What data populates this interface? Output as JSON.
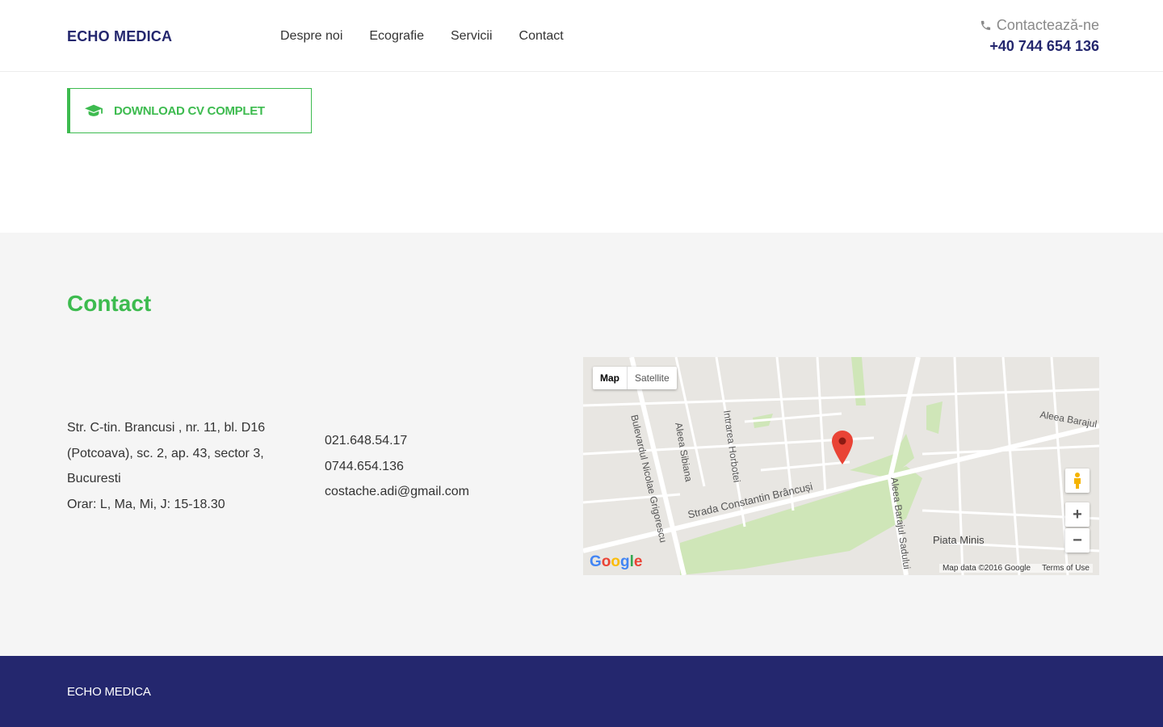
{
  "header": {
    "logo": "ECHO MEDICA",
    "nav": [
      "Despre noi",
      "Ecografie",
      "Servicii",
      "Contact"
    ],
    "contact_label": "Contactează-ne",
    "phone": "+40 744 654 136"
  },
  "download": {
    "label": "DOWNLOAD CV COMPLET",
    "icon": "graduation-cap-icon"
  },
  "contact": {
    "title": "Contact",
    "address_lines": [
      "Str. C-tin. Brancusi , nr. 11, bl. D16",
      "(Potcoava), sc. 2, ap. 43, sector 3,",
      "Bucuresti",
      "Orar: L, Ma, Mi, J: 15-18.30"
    ],
    "phones": [
      "021.648.54.17",
      "0744.654.136",
      "costache.adi@gmail.com"
    ]
  },
  "map": {
    "type_map": "Map",
    "type_satellite": "Satellite",
    "zoom_in": "+",
    "zoom_out": "−",
    "streets": [
      "Bulevardul Nicolae Grigorescu",
      "Aleea Sibiana",
      "Intrarea Horbotei",
      "Strada Constantin Brâncuși",
      "Aleea Barajul Sadului",
      "Aleea Barajul",
      "Piata Minis"
    ],
    "credit": "Map data ©2016 Google",
    "terms": "Terms of Use",
    "google": "Google"
  },
  "footer": {
    "logo": "ECHO MEDICA"
  },
  "colors": {
    "brand": "#24276e",
    "accent": "#3dbb4f"
  }
}
